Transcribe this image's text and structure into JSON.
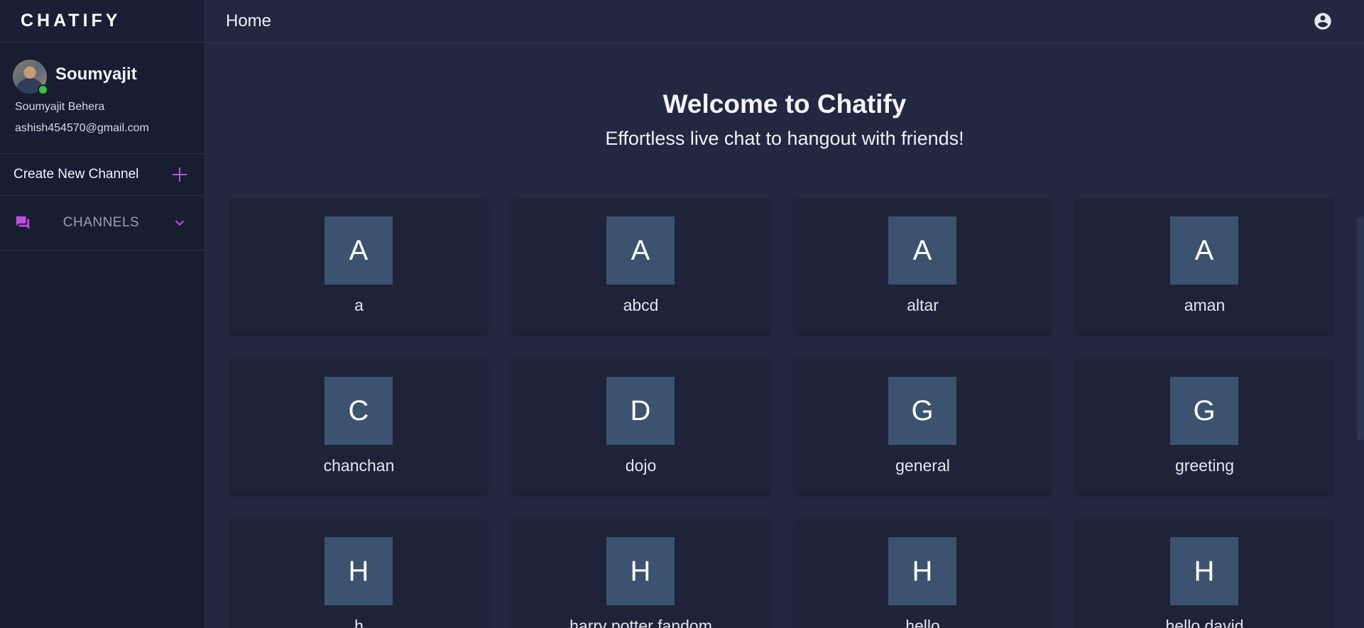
{
  "app": {
    "brand": "CHATIFY"
  },
  "header": {
    "title": "Home",
    "account_icon": "account-circle-icon"
  },
  "user": {
    "display_name": "Soumyajit",
    "full_name": "Soumyajit Behera",
    "email": "ashish454570@gmail.com",
    "status": "online"
  },
  "sidebar": {
    "create_channel_label": "Create New Channel",
    "channels_label": "CHANNELS"
  },
  "welcome": {
    "title": "Welcome to Chatify",
    "subtitle": "Effortless live chat to hangout with friends!"
  },
  "channels": [
    {
      "initial": "A",
      "name": "a"
    },
    {
      "initial": "A",
      "name": "abcd"
    },
    {
      "initial": "A",
      "name": "altar"
    },
    {
      "initial": "A",
      "name": "aman"
    },
    {
      "initial": "C",
      "name": "chanchan"
    },
    {
      "initial": "D",
      "name": "dojo"
    },
    {
      "initial": "G",
      "name": "general"
    },
    {
      "initial": "G",
      "name": "greeting"
    },
    {
      "initial": "H",
      "name": "h"
    },
    {
      "initial": "H",
      "name": "harry potter fandom"
    },
    {
      "initial": "H",
      "name": "hello"
    },
    {
      "initial": "H",
      "name": "hello david"
    }
  ],
  "colors": {
    "accent": "#c04de0",
    "online": "#3fc03f",
    "card_avatar_bg": "#3b536e",
    "background": "#222840",
    "sidebar_bg": "#181d32"
  }
}
